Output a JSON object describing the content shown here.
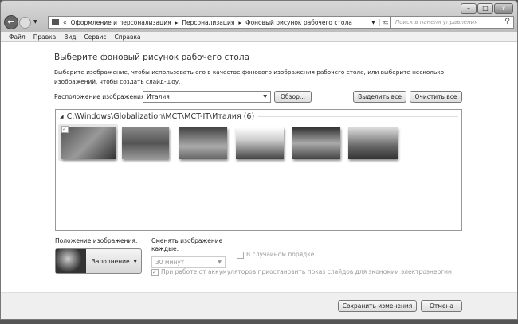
{
  "window": {
    "minimize": "–",
    "maximize": "□",
    "close": "x"
  },
  "nav": {
    "breadcrumb": [
      "«",
      "Оформление и персонализация",
      "Персонализация",
      "Фоновый рисунок рабочего стола"
    ],
    "search_placeholder": "Поиск в панели управления"
  },
  "menu": [
    "Файл",
    "Правка",
    "Вид",
    "Сервис",
    "Справка"
  ],
  "main": {
    "title": "Выберите фоновый рисунок рабочего стола",
    "description": "Выберите изображение, чтобы использовать его в качестве фонового изображения рабочего стола, или выберите несколько изображений, чтобы создать слайд-шоу.",
    "location_label": "Расположение изображения:",
    "location_value": "Италия",
    "browse": "Обзор...",
    "select_all": "Выделить все",
    "clear_all": "Очистить все",
    "group_header": "C:\\Windows\\Globalization\\MCT\\MCT-IT\\Италия (6)",
    "position_label": "Положение изображения:",
    "position_value": "Заполнение",
    "interval_label": "Сменять изображение каждые:",
    "interval_value": "30 минут",
    "shuffle_label": "В случайном порядке",
    "battery_label": "При работе от аккумуляторов приостановить показ слайдов для экономии электроэнергии"
  },
  "footer": {
    "save": "Сохранить изменения",
    "cancel": "Отмена"
  }
}
